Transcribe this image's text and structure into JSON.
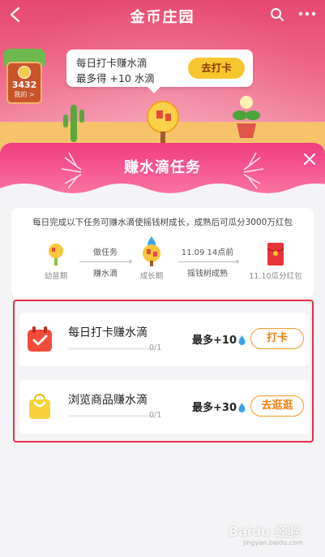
{
  "header": {
    "title": "金币庄园",
    "icons": [
      "back-icon",
      "search-icon",
      "more-icon"
    ]
  },
  "wallet": {
    "amount": "3432",
    "label": "我的 >"
  },
  "bubble": {
    "line1": "每日打卡赚水滴",
    "line2": "最多得 +10 水滴",
    "button": "去打卡"
  },
  "modal": {
    "title": "赚水滴任务",
    "intro": "每日完成以下任务可赚水滴使摇钱树成长，成熟后可瓜分3000万红包",
    "stages": [
      {
        "label": "幼苗期"
      },
      {
        "label": "成长期"
      },
      {
        "label": "11.10瓜分红包"
      }
    ],
    "steps": [
      {
        "line1": "做任务",
        "line2": "赚水滴"
      },
      {
        "line1": "11.09 14点前",
        "line2": "摇钱树成熟"
      }
    ],
    "tasks": [
      {
        "name": "每日打卡赚水滴",
        "progress": "0/1",
        "progress_fraction": 0,
        "reward": "最多+10",
        "button": "打卡",
        "icon": "calendar-check-icon"
      },
      {
        "name": "浏览商品赚水滴",
        "progress": "0/1",
        "progress_fraction": 0,
        "reward": "最多+30",
        "button": "去逛逛",
        "icon": "shopping-bag-icon"
      }
    ]
  },
  "watermark": {
    "text": "Baidu 经验",
    "sub": "jingyan.baidu.com"
  },
  "colors": {
    "accent_pink": "#f13c7e",
    "button_orange": "#f07d10",
    "highlight_red": "#e6304a",
    "yellow_button": "#f7c62f"
  }
}
